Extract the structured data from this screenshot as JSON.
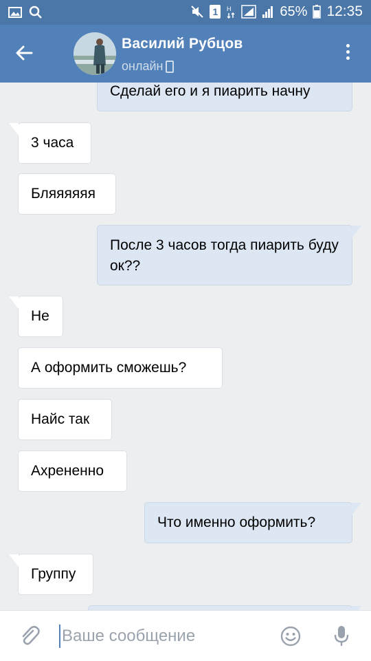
{
  "status_bar": {
    "battery": "65%",
    "time": "12:35",
    "sim_label": "1"
  },
  "header": {
    "contact_name": "Василий Рубцов",
    "presence": "онлайн"
  },
  "messages": [
    {
      "dir": "out",
      "text": "Сделай его и я пиарить начну"
    },
    {
      "dir": "in",
      "text": "3 часа"
    },
    {
      "dir": "in",
      "text": "Бляяяяяя"
    },
    {
      "dir": "out",
      "text": "После 3 часов тогда пиарить буду ок??"
    },
    {
      "dir": "in",
      "text": "Не"
    },
    {
      "dir": "in",
      "text": "А оформить сможешь?"
    },
    {
      "dir": "in",
      "text": "Найс так"
    },
    {
      "dir": "in",
      "text": "Ахрененно"
    },
    {
      "dir": "out",
      "text": "Что именно оформить?"
    },
    {
      "dir": "in",
      "text": "Группу"
    },
    {
      "dir": "out",
      "text": ""
    }
  ],
  "composer": {
    "placeholder": "Ваше сообщение"
  },
  "colors": {
    "header": "#5181b8",
    "status_bar": "#4a76a8",
    "outgoing_bubble": "#dde7f4",
    "incoming_bubble": "#ffffff",
    "background": "#edeef0"
  }
}
